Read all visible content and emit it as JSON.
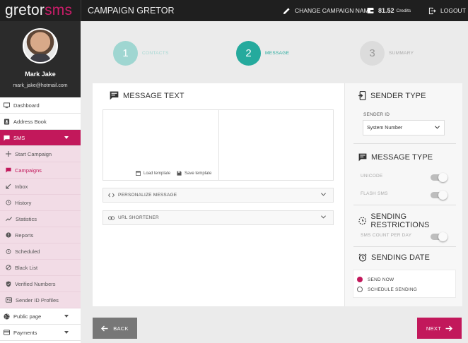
{
  "topbar": {
    "logo_a": "gretor",
    "logo_b": "sms",
    "campaign_title": "CAMPAIGN GRETOR",
    "change_name": "CHANGE CAMPAIGN NAME",
    "credits_amount": "81.52",
    "credits_label": "Credits",
    "logout": "LOGOUT"
  },
  "profile": {
    "name": "Mark Jake",
    "email": "mark_jake@hotmail.com"
  },
  "nav": {
    "dashboard": "Dashboard",
    "address_book": "Address Book",
    "sms": "SMS",
    "sms_sub": {
      "start_campaign": "Start Campaign",
      "campaigns": "Campaigns",
      "inbox": "Inbox",
      "history": "History",
      "statistics": "Statistics",
      "reports": "Reports",
      "scheduled": "Scheduled",
      "black_list": "Black List",
      "verified_numbers": "Verified Numbers",
      "sender_id_profiles": "Sender ID Profiles"
    },
    "public_page": "Public page",
    "payments": "Payments"
  },
  "steps": [
    {
      "num": "1",
      "label": "CONTACTS"
    },
    {
      "num": "2",
      "label": "MESSAGE"
    },
    {
      "num": "3",
      "label": "SUMMARY"
    }
  ],
  "message": {
    "title": "MESSAGE TEXT",
    "load_template": "Load template",
    "save_template": "Save template",
    "personalize": "PERSONALIZE MESSAGE",
    "url_shortener": "URL SHORTENER"
  },
  "sender": {
    "title": "SENDER TYPE",
    "sender_id_label": "SENDER ID",
    "sender_id_value": "System Number"
  },
  "message_type": {
    "title": "MESSAGE TYPE",
    "unicode": "UNICODE",
    "flash": "FLASH SMS"
  },
  "restrictions": {
    "title": "SENDING RESTRICTIONS",
    "count_per_day": "SMS COUNT PER DAY"
  },
  "sending_date": {
    "title": "SENDING DATE",
    "send_now": "SEND NOW",
    "schedule": "SCHEDULE SENDING"
  },
  "buttons": {
    "back": "BACK",
    "next": "NEXT"
  },
  "colors": {
    "accent": "#c2185b",
    "step_current": "#25aa9d",
    "step_done": "#9fd6d1"
  }
}
